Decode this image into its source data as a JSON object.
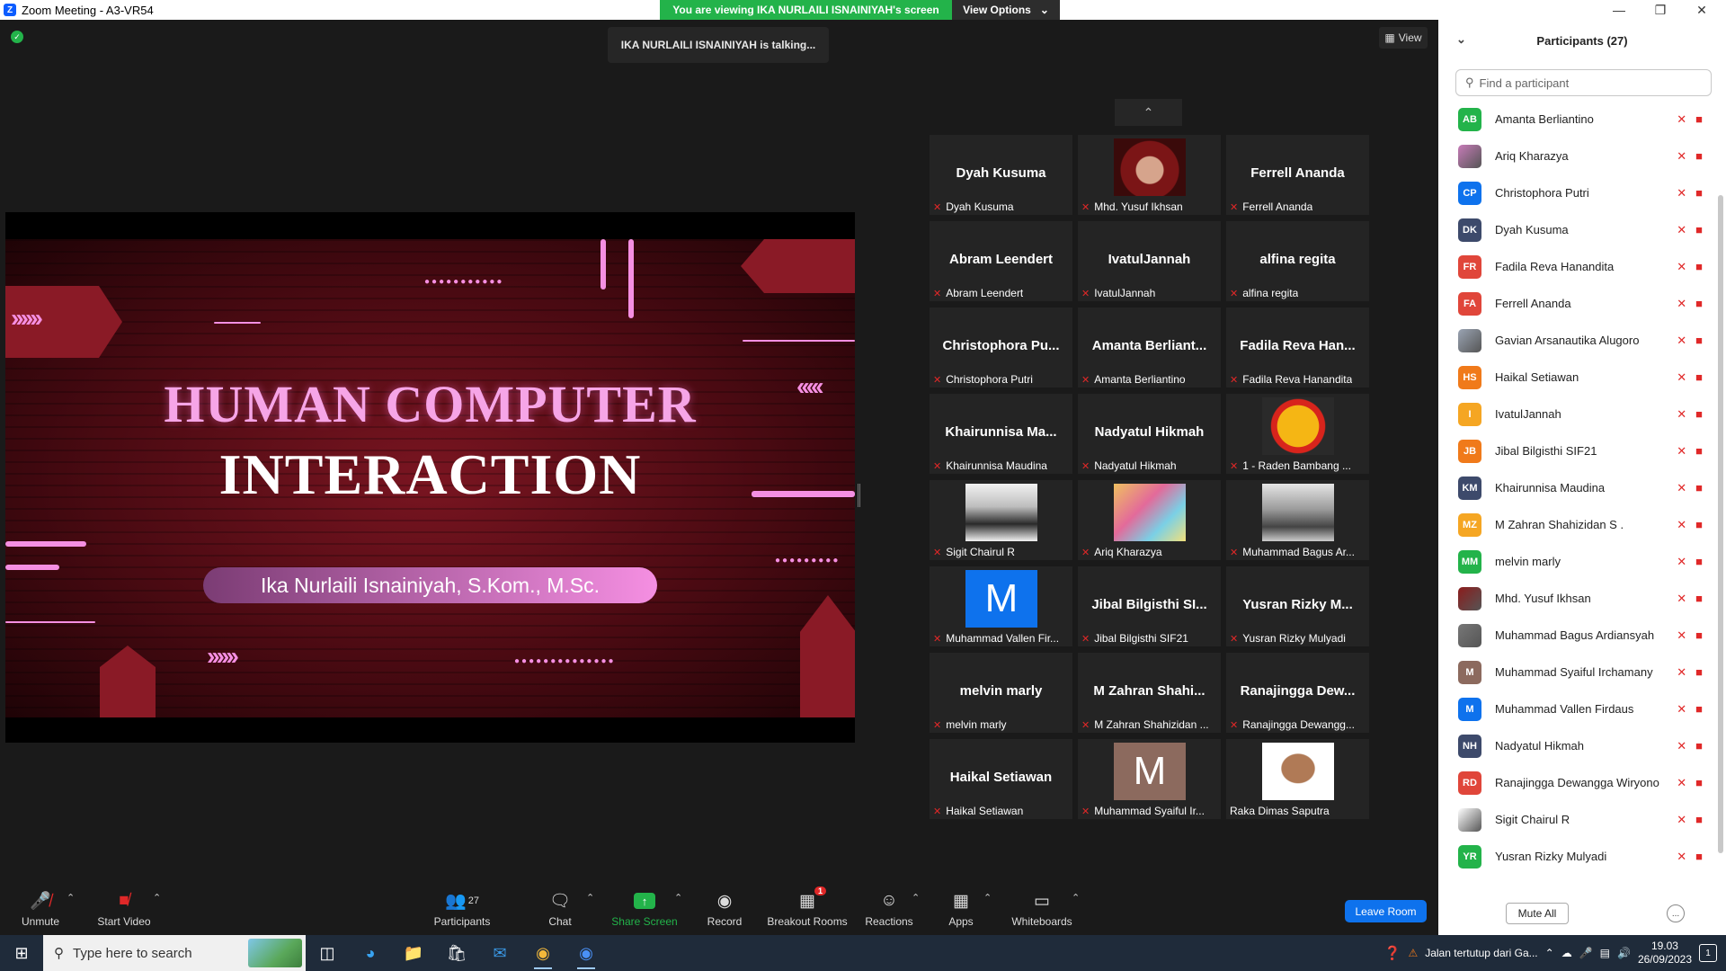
{
  "window": {
    "title": "Zoom Meeting - A3-VR54",
    "app_icon_letter": "Z"
  },
  "banner": {
    "message": "You are viewing IKA NURLAILI ISNAINIYAH's screen",
    "view_options": "View Options"
  },
  "talking": "IKA NURLAILI ISNAINIYAH is talking...",
  "view_button": "View",
  "slide": {
    "title_line1": "HUMAN COMPUTER",
    "title_line2": "INTERACTION",
    "presenter": "Ika Nurlaili Isnainiyah, S.Kom., M.Sc."
  },
  "gallery": [
    {
      "display": "Dyah Kusuma",
      "name": "Dyah Kusuma"
    },
    {
      "display": "",
      "name": "Mhd. Yusuf Ikhsan",
      "image": "photo-red"
    },
    {
      "display": "Ferrell Ananda",
      "name": "Ferrell Ananda"
    },
    {
      "display": "Abram Leendert",
      "name": "Abram Leendert"
    },
    {
      "display": "IvatulJannah",
      "name": "IvatulJannah"
    },
    {
      "display": "alfina regita",
      "name": "alfina regita"
    },
    {
      "display": "Christophora Pu...",
      "name": "Christophora Putri"
    },
    {
      "display": "Amanta Berliant...",
      "name": "Amanta Berliantino"
    },
    {
      "display": "Fadila Reva Han...",
      "name": "Fadila Reva Hanandita"
    },
    {
      "display": "Khairunnisa Ma...",
      "name": "Khairunnisa Maudina"
    },
    {
      "display": "Nadyatul Hikmah",
      "name": "Nadyatul Hikmah"
    },
    {
      "display": "",
      "name": "1 - Raden Bambang ...",
      "image": "photo-yellow"
    },
    {
      "display": "",
      "name": "Sigit Chairul R",
      "image": "photo-bw"
    },
    {
      "display": "",
      "name": "Ariq Kharazya",
      "image": "photo-colorful"
    },
    {
      "display": "",
      "name": "Muhammad Bagus Ar...",
      "image": "photo-gray"
    },
    {
      "display": "",
      "name": "Muhammad Vallen Fir...",
      "letter": "M",
      "color": "#0e72ed"
    },
    {
      "display": "Jibal Bilgisthi SI...",
      "name": "Jibal Bilgisthi SIF21"
    },
    {
      "display": "Yusran Rizky M...",
      "name": "Yusran Rizky Mulyadi"
    },
    {
      "display": "melvin marly",
      "name": "melvin marly"
    },
    {
      "display": "M Zahran Shahi...",
      "name": "M Zahran Shahizidan ..."
    },
    {
      "display": "Ranajingga Dew...",
      "name": "Ranajingga Dewangg..."
    },
    {
      "display": "Haikal Setiawan",
      "name": "Haikal Setiawan"
    },
    {
      "display": "",
      "name": "Muhammad Syaiful Ir...",
      "letter": "M",
      "color": "#8c6a5e"
    },
    {
      "display": "",
      "name": "Raka Dimas Saputra",
      "image": "photo-face",
      "unmuted": true
    }
  ],
  "toolbar": {
    "unmute": "Unmute",
    "start_video": "Start Video",
    "participants": "Participants",
    "participants_count": "27",
    "chat": "Chat",
    "share_screen": "Share Screen",
    "record": "Record",
    "breakout_rooms": "Breakout Rooms",
    "breakout_badge": "1",
    "reactions": "Reactions",
    "apps": "Apps",
    "whiteboards": "Whiteboards",
    "leave_room": "Leave Room"
  },
  "panel": {
    "title": "Participants (27)",
    "search_placeholder": "Find a participant",
    "mute_all": "Mute All",
    "more": "..."
  },
  "participants": [
    {
      "initials": "AB",
      "name": "Amanta Berliantino",
      "color": "#23b34a"
    },
    {
      "initials": "",
      "name": "Ariq Kharazya",
      "color": "#c77bb8",
      "image": true
    },
    {
      "initials": "CP",
      "name": "Christophora Putri",
      "color": "#0e72ed"
    },
    {
      "initials": "DK",
      "name": "Dyah Kusuma",
      "color": "#3d4a6b"
    },
    {
      "initials": "FR",
      "name": "Fadila Reva Hanandita",
      "color": "#e0463a"
    },
    {
      "initials": "FA",
      "name": "Ferrell Ananda",
      "color": "#e0463a"
    },
    {
      "initials": "",
      "name": "Gavian Arsanautika Alugoro",
      "color": "#9aa4b3",
      "image": true
    },
    {
      "initials": "HS",
      "name": "Haikal Setiawan",
      "color": "#f07a1a"
    },
    {
      "initials": "I",
      "name": "IvatulJannah",
      "color": "#f5a623"
    },
    {
      "initials": "JB",
      "name": "Jibal Bilgisthi SIF21",
      "color": "#f07a1a"
    },
    {
      "initials": "KM",
      "name": "Khairunnisa Maudina",
      "color": "#3d4a6b"
    },
    {
      "initials": "MZ",
      "name": "M Zahran Shahizidan S .",
      "color": "#f5a623"
    },
    {
      "initials": "MM",
      "name": "melvin marly",
      "color": "#23b34a"
    },
    {
      "initials": "",
      "name": "Mhd. Yusuf Ikhsan",
      "color": "#8b1c1c",
      "image": true
    },
    {
      "initials": "",
      "name": "Muhammad Bagus Ardiansyah",
      "color": "#777777",
      "image": true
    },
    {
      "initials": "M",
      "name": "Muhammad Syaiful Irchamany",
      "color": "#8c6a5e"
    },
    {
      "initials": "M",
      "name": "Muhammad Vallen Firdaus",
      "color": "#0e72ed"
    },
    {
      "initials": "NH",
      "name": "Nadyatul Hikmah",
      "color": "#3d4a6b"
    },
    {
      "initials": "RD",
      "name": "Ranajingga Dewangga Wiryono",
      "color": "#e0463a"
    },
    {
      "initials": "",
      "name": "Sigit Chairul R",
      "color": "#ffffff",
      "image": true
    },
    {
      "initials": "YR",
      "name": "Yusran Rizky Mulyadi",
      "color": "#23b34a"
    }
  ],
  "taskbar": {
    "search_placeholder": "Type here to search",
    "weather_text": "Jalan tertutup dari Ga...",
    "time": "19.03",
    "date": "26/09/2023",
    "notifications": "1"
  },
  "icons": {
    "mic_off": "mic-off-icon",
    "video_off": "video-off-icon",
    "windows": "windows-start-icon"
  }
}
